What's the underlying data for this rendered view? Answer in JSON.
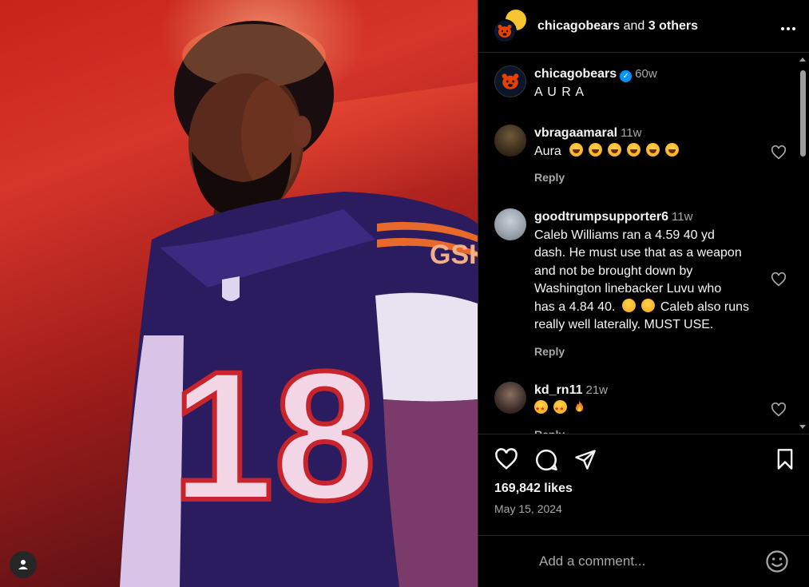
{
  "post": {
    "header": {
      "username": "chicagobears",
      "and_text": " and ",
      "others": "3 others",
      "more_icon": "more-horizontal-icon"
    },
    "caption": {
      "username": "chicagobears",
      "verified": true,
      "time": "60w",
      "text": "A U R A"
    },
    "comments": [
      {
        "username": "vbragaamaral",
        "time": "11w",
        "text": "Aura",
        "emoji": [
          "laughing",
          "laughing",
          "laughing",
          "laughing",
          "laughing",
          "laughing"
        ],
        "reply_label": "Reply"
      },
      {
        "username": "goodtrumpsupporter6",
        "time": "11w",
        "lines": [
          "Caleb Williams ran a 4.59 40 yd",
          "dash. He must use that as a weapon",
          "and not be brought down by",
          "Washington linebacker Luvu who",
          "has a 4.84 40.",
          "Caleb also runs",
          "really well laterally. MUST USE."
        ],
        "reply_label": "Reply"
      },
      {
        "username": "kd_rn11",
        "time": "21w",
        "emoji": [
          "star-struck",
          "star-struck",
          "fire"
        ],
        "reply_label": "Reply"
      }
    ],
    "likes": "169,842 likes",
    "date": "May 15, 2024",
    "comment_placeholder": "Add a comment...",
    "colors": {
      "background": "#000000",
      "muted": "#a8a8a8",
      "verified": "#0095f6",
      "bears_navy": "#0b162a",
      "bears_orange": "#e64100"
    }
  }
}
